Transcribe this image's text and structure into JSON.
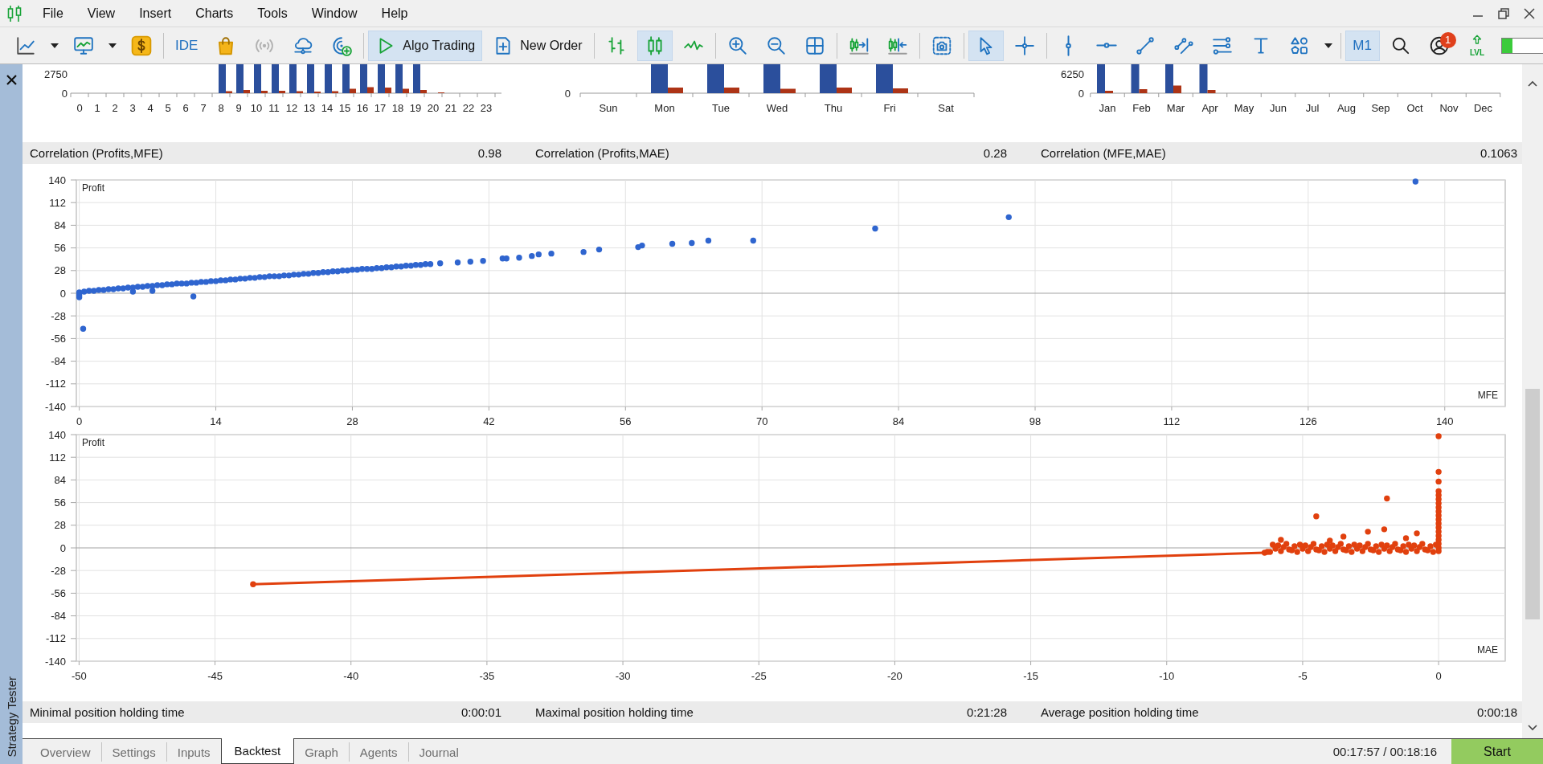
{
  "menu": {
    "items": [
      "File",
      "View",
      "Insert",
      "Charts",
      "Tools",
      "Window",
      "Help"
    ]
  },
  "toolbar": {
    "groups": [
      [
        {
          "kind": "newchart",
          "pressed": false,
          "disabled": false
        },
        {
          "kind": "caret",
          "pressed": false,
          "disabled": false
        },
        {
          "kind": "template",
          "pressed": false,
          "disabled": false
        },
        {
          "kind": "caret",
          "pressed": false,
          "disabled": false
        },
        {
          "kind": "dollar",
          "pressed": false,
          "disabled": false
        }
      ],
      [
        {
          "kind": "ide",
          "label": "IDE",
          "pressed": false,
          "disabled": false
        },
        {
          "kind": "bag",
          "pressed": false,
          "disabled": false
        },
        {
          "kind": "signal",
          "pressed": false,
          "disabled": true
        },
        {
          "kind": "cloud",
          "pressed": false,
          "disabled": false
        },
        {
          "kind": "target",
          "pressed": false,
          "disabled": false
        }
      ],
      [
        {
          "kind": "play",
          "label": "Algo Trading",
          "pressed": true,
          "disabled": false
        },
        {
          "kind": "order",
          "label": "New Order",
          "pressed": false,
          "disabled": false
        }
      ],
      [
        {
          "kind": "bars",
          "pressed": false,
          "disabled": false
        },
        {
          "kind": "candles",
          "pressed": true,
          "disabled": false
        },
        {
          "kind": "line",
          "pressed": false,
          "disabled": false
        }
      ],
      [
        {
          "kind": "zoomin",
          "pressed": false,
          "disabled": false
        },
        {
          "kind": "zoomout",
          "pressed": false,
          "disabled": false
        },
        {
          "kind": "tile",
          "pressed": false,
          "disabled": false
        }
      ],
      [
        {
          "kind": "shiftend",
          "pressed": false,
          "disabled": false
        },
        {
          "kind": "autoscroll",
          "pressed": false,
          "disabled": false
        }
      ],
      [
        {
          "kind": "screenshot",
          "pressed": false,
          "disabled": false
        }
      ],
      [
        {
          "kind": "cursor",
          "pressed": true,
          "disabled": false
        },
        {
          "kind": "crosshair",
          "pressed": false,
          "disabled": false
        }
      ],
      [
        {
          "kind": "vline",
          "pressed": false,
          "disabled": false
        },
        {
          "kind": "hline",
          "pressed": false,
          "disabled": false
        },
        {
          "kind": "trend",
          "pressed": false,
          "disabled": false
        },
        {
          "kind": "channel",
          "pressed": false,
          "disabled": false
        },
        {
          "kind": "fibo",
          "pressed": false,
          "disabled": false
        },
        {
          "kind": "textool",
          "pressed": false,
          "disabled": false
        },
        {
          "kind": "shapes",
          "pressed": false,
          "disabled": false
        },
        {
          "kind": "caret",
          "pressed": false,
          "disabled": false
        }
      ],
      [
        {
          "kind": "period",
          "label": "M1",
          "pressed": true,
          "disabled": false
        },
        {
          "kind": "search",
          "pressed": false,
          "disabled": false
        },
        {
          "kind": "account",
          "badge": "1",
          "pressed": false,
          "disabled": false
        },
        {
          "kind": "lvl",
          "label": "LVL",
          "pressed": false,
          "disabled": false
        }
      ]
    ],
    "meter": {
      "level": 0.2
    }
  },
  "side_panel": {
    "title": "Strategy Tester"
  },
  "top_charts": [
    {
      "y_labels": [
        "2750",
        "0"
      ],
      "categories": [
        "0",
        "1",
        "2",
        "3",
        "4",
        "5",
        "6",
        "7",
        "8",
        "9",
        "10",
        "11",
        "12",
        "13",
        "14",
        "15",
        "16",
        "17",
        "18",
        "19",
        "20",
        "21",
        "22",
        "23"
      ]
    },
    {
      "y_labels": [
        "0"
      ],
      "categories": [
        "Sun",
        "Mon",
        "Tue",
        "Wed",
        "Thu",
        "Fri",
        "Sat"
      ]
    },
    {
      "y_labels": [
        "6250",
        "0"
      ],
      "categories": [
        "Jan",
        "Feb",
        "Mar",
        "Apr",
        "May",
        "Jun",
        "Jul",
        "Aug",
        "Sep",
        "Oct",
        "Nov",
        "Dec"
      ]
    }
  ],
  "correlations": [
    {
      "label": "Correlation (Profits,MFE)",
      "value": "0.98"
    },
    {
      "label": "Correlation (Profits,MAE)",
      "value": "0.28"
    },
    {
      "label": "Correlation (MFE,MAE)",
      "value": "0.1063"
    }
  ],
  "scatter_charts": [
    {
      "chart_data": {
        "type": "scatter",
        "xlabel": "MFE",
        "ylabel": "Profit",
        "grid": true,
        "xlim": [
          -0.3,
          146.2
        ],
        "ylim": [
          -140,
          140
        ],
        "xticks": [
          0,
          14,
          28,
          42,
          56,
          70,
          84,
          98,
          112,
          126,
          140
        ],
        "yticks": [
          -140,
          -112,
          -84,
          -56,
          -28,
          0,
          28,
          56,
          84,
          112,
          140
        ],
        "x": [
          0,
          0,
          0,
          0.5,
          0.4,
          5.5,
          7.5,
          11.7,
          1,
          1.5,
          2,
          2.5,
          3,
          3.5,
          4,
          4.5,
          5,
          5.5,
          6,
          6.5,
          7,
          7.5,
          8,
          8.5,
          9,
          9.5,
          10,
          10.5,
          11,
          11.5,
          12,
          12.5,
          13,
          13.5,
          14,
          14.5,
          15,
          15.5,
          16,
          16.5,
          17,
          17.5,
          18,
          18.5,
          19,
          19.5,
          20,
          20.5,
          21,
          21.5,
          22,
          22.5,
          23,
          23.5,
          24,
          24.5,
          25,
          25.5,
          26,
          26.5,
          27,
          27.5,
          28,
          28.5,
          29,
          29.5,
          30,
          30.5,
          31,
          31.5,
          32,
          32.5,
          33,
          33.5,
          34,
          34.5,
          35,
          35.5,
          36,
          37,
          38.8,
          40.1,
          41.4,
          43.4,
          43.8,
          45.1,
          46.4,
          47.1,
          48.4,
          51.7,
          53.3,
          57.3,
          57.7,
          60.8,
          62.8,
          64.5,
          69.1,
          81.6,
          95.3,
          137
        ],
        "series": [
          {
            "color": "#2f65cf",
            "values": [
              -5,
              -2,
              1,
              2,
              -44,
              2,
              3,
              -4,
              3,
              3,
              4,
              4,
              5,
              5,
              6,
              6,
              7,
              7,
              8,
              8,
              9,
              9,
              10,
              10,
              11,
              11,
              12,
              12,
              12,
              13,
              13,
              14,
              14,
              15,
              15,
              16,
              16,
              17,
              17,
              18,
              18,
              19,
              19,
              20,
              20,
              21,
              21,
              21,
              22,
              22,
              23,
              23,
              24,
              24,
              25,
              25,
              26,
              26,
              27,
              27,
              28,
              28,
              29,
              29,
              30,
              30,
              30,
              31,
              31,
              32,
              32,
              33,
              33,
              34,
              34,
              35,
              35,
              36,
              36,
              37,
              38,
              39,
              40,
              43,
              43,
              44,
              46,
              48,
              49,
              51,
              54,
              57,
              59,
              61,
              62,
              65,
              65,
              80,
              94,
              138
            ]
          }
        ]
      }
    },
    {
      "chart_data": {
        "type": "scatter",
        "xlabel": "MAE",
        "ylabel": "Profit",
        "grid": true,
        "xlim": [
          -50.1,
          2.45
        ],
        "ylim": [
          -140,
          140
        ],
        "xticks": [
          -50,
          -45,
          -40,
          -35,
          -30,
          -25,
          -20,
          -15,
          -10,
          -5,
          0
        ],
        "yticks": [
          -140,
          -112,
          -84,
          -56,
          -28,
          0,
          28,
          56,
          84,
          112,
          140
        ],
        "x": [
          -43.6,
          -6.4,
          -6.3,
          -6.2,
          -6.1,
          -6.0,
          -5.9,
          -5.8,
          -5.7,
          -5.6,
          -5.5,
          -5.4,
          -5.3,
          -5.2,
          -5.1,
          -5.0,
          -4.9,
          -4.8,
          -4.7,
          -4.6,
          -4.5,
          -4.4,
          -4.3,
          -4.2,
          -4.1,
          -4.0,
          -3.9,
          -3.8,
          -3.7,
          -3.6,
          -3.5,
          -3.4,
          -3.3,
          -3.2,
          -3.1,
          -3.0,
          -2.9,
          -2.8,
          -2.7,
          -2.6,
          -2.5,
          -2.4,
          -2.3,
          -2.2,
          -2.1,
          -2.0,
          -1.9,
          -1.8,
          -1.7,
          -1.6,
          -1.5,
          -1.4,
          -1.3,
          -1.2,
          -1.1,
          -1.0,
          -0.9,
          -0.8,
          -0.7,
          -0.6,
          -0.5,
          -0.4,
          -0.3,
          -0.2,
          -0.1,
          -5.8,
          -4.5,
          -4.0,
          -3.5,
          -2.6,
          -2.0,
          -1.9,
          -1.2,
          -0.8,
          0,
          0,
          0,
          0,
          0,
          0,
          0,
          0,
          0,
          0,
          0,
          0,
          0,
          0,
          0,
          0,
          0,
          0,
          0
        ],
        "series": [
          {
            "color": "#e1400e",
            "values": [
              -45,
              -6,
              -5,
              -5,
              4,
              -1,
              3,
              -4,
              1,
              5,
              -2,
              -3,
              2,
              -5,
              4,
              -1,
              3,
              -4,
              1,
              5,
              -2,
              -3,
              2,
              -5,
              4,
              -1,
              3,
              -4,
              1,
              5,
              -2,
              -3,
              2,
              -5,
              4,
              -1,
              3,
              -4,
              1,
              5,
              -2,
              -3,
              2,
              -5,
              4,
              -1,
              3,
              -4,
              1,
              5,
              -2,
              -3,
              2,
              -5,
              4,
              -1,
              3,
              -4,
              1,
              5,
              -2,
              -3,
              2,
              -5,
              4,
              10,
              39,
              9,
              14,
              20,
              23,
              61,
              12,
              18,
              -4,
              0,
              5,
              10,
              15,
              20,
              25,
              30,
              35,
              40,
              45,
              50,
              55,
              60,
              65,
              70,
              82,
              94,
              138
            ]
          },
          {
            "type": "line",
            "color": "#e1400e",
            "values": [
              -45,
              -6,
              null,
              null,
              null,
              null,
              null,
              null,
              null,
              null,
              null,
              null,
              null,
              null,
              null,
              null,
              null,
              null,
              null,
              null,
              null,
              null,
              null,
              null,
              null,
              null,
              null,
              null,
              null,
              null,
              null,
              null,
              null,
              null,
              null,
              null,
              null,
              null,
              null,
              null,
              null,
              null,
              null,
              null,
              null,
              null,
              null,
              null,
              null,
              null,
              null,
              null,
              null,
              null,
              null,
              null,
              null,
              null,
              null,
              null,
              null,
              null,
              null,
              null,
              null,
              null,
              null,
              null,
              null,
              null,
              null,
              null,
              null,
              null,
              null,
              null,
              null,
              null,
              null,
              null,
              null,
              null,
              null,
              null,
              null,
              null,
              null,
              null,
              null,
              null,
              null,
              null,
              null
            ]
          }
        ]
      }
    }
  ],
  "holding_times": [
    {
      "label": "Minimal position holding time",
      "value": "0:00:01"
    },
    {
      "label": "Maximal position holding time",
      "value": "0:21:28"
    },
    {
      "label": "Average position holding time",
      "value": "0:00:18"
    }
  ],
  "tabs": [
    {
      "label": "Overview",
      "selected": false
    },
    {
      "label": "Settings",
      "selected": false
    },
    {
      "label": "Inputs",
      "selected": false
    },
    {
      "label": "Backtest",
      "selected": true
    },
    {
      "label": "Graph",
      "selected": false
    },
    {
      "label": "Agents",
      "selected": false
    },
    {
      "label": "Journal",
      "selected": false
    }
  ],
  "status": {
    "time": "00:17:57 / 00:18:16",
    "start_button": "Start"
  }
}
